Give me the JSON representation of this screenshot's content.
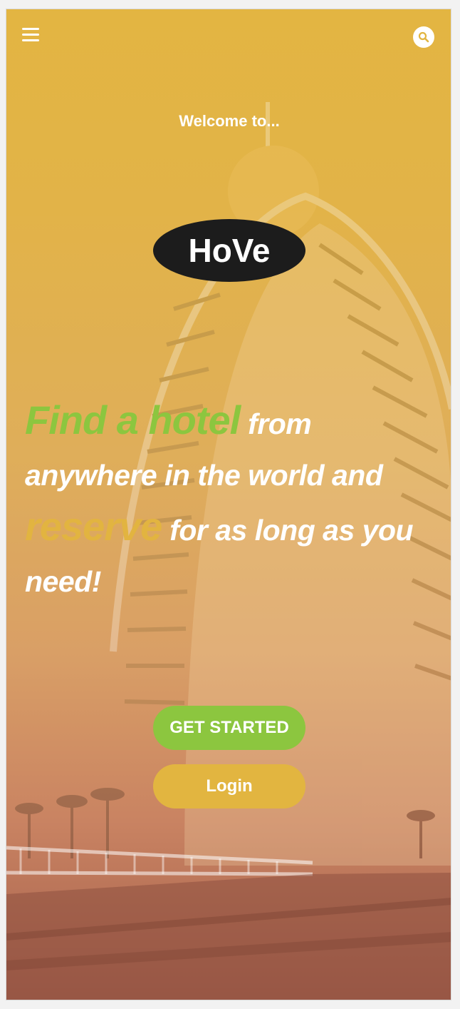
{
  "header": {
    "menu_icon": "hamburger-menu-icon",
    "search_icon": "search-icon"
  },
  "hero": {
    "welcome_text": "Welcome to...",
    "logo_text": "HoVe",
    "headline": {
      "highlight_1": "Find a hotel",
      "text_1": " from anywhere in the world and ",
      "highlight_2": "reserve",
      "text_2": " for as long as you need!"
    }
  },
  "actions": {
    "get_started_label": "GET STARTED",
    "login_label": "Login"
  },
  "colors": {
    "primary_gold": "#e2b540",
    "accent_green": "#8cc63f",
    "logo_black": "#1c1c1c",
    "text_white": "#ffffff"
  }
}
